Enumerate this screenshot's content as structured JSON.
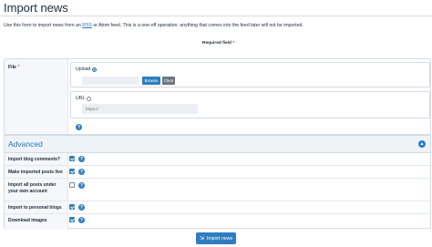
{
  "page": {
    "title": "Import news",
    "intro_prefix": "Use this form to import news from an ",
    "intro_rss": "RSS",
    "intro_middle": " or Atom feed. This is a one-off operation: anything that comes into the feed later will not be imported.",
    "required_note": "Required field",
    "required_star": "*"
  },
  "file_section": {
    "label": "File",
    "star": "*",
    "upload": {
      "label": "Upload",
      "selected": true,
      "browse_label": "Browse",
      "clear_label": "Clear"
    },
    "url": {
      "label": "URL",
      "selected": false,
      "placeholder": "https://",
      "value": ""
    }
  },
  "advanced": {
    "title": "Advanced",
    "collapse_icon": "chevron-up-icon",
    "options": [
      {
        "label": "Import blog comments?",
        "checked": true
      },
      {
        "label": "Make imported posts live",
        "checked": true
      },
      {
        "label": "Import all posts under your own account",
        "checked": false
      },
      {
        "label": "Import to personal blogs",
        "checked": true
      },
      {
        "label": "Download images",
        "checked": true
      }
    ]
  },
  "submit": {
    "label": "Import news",
    "icon": "import-icon"
  },
  "colors": {
    "accent": "#2f7dc1",
    "link": "#2577b1",
    "required": "#8f2325"
  }
}
